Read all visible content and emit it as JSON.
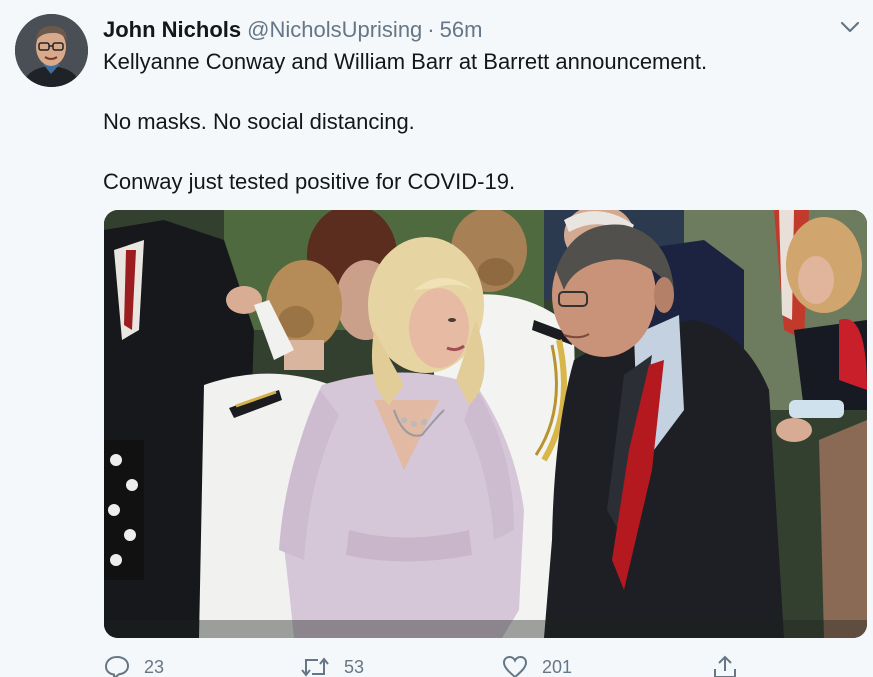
{
  "tweet": {
    "author_name": "John Nichols",
    "author_handle": "@NicholsUprising",
    "separator": "·",
    "timestamp": "56m",
    "lines": [
      "Kellyanne Conway and William Barr at Barrett announcement.",
      "No masks. No social distancing.",
      "Conway just tested positive for COVID-19."
    ]
  },
  "actions": {
    "reply_count": "23",
    "retweet_count": "53",
    "like_count": "201"
  },
  "icons": {
    "menu": "chevron-down-icon",
    "reply": "reply-icon",
    "retweet": "retweet-icon",
    "like": "heart-icon",
    "share": "share-icon"
  },
  "colors": {
    "background": "#f5f8fa",
    "text": "#14171a",
    "secondary": "#657786"
  }
}
